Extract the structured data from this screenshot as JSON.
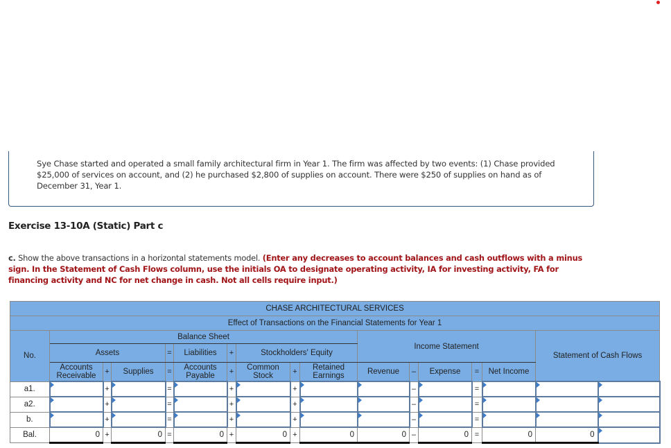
{
  "problem": {
    "text": "Sye Chase started and operated a small family architectural firm in Year 1. The firm was affected by two events: (1) Chase provided $25,000 of services on account, and (2) he purchased $2,800 of supplies on account. There were $250 of supplies on hand as of December 31, Year 1."
  },
  "exercise": {
    "title": "Exercise 13-10A (Static) Part c"
  },
  "instructions": {
    "part_label": "c.",
    "text": " Show the above transactions in a horizontal statements model. ",
    "note": "(Enter any decreases to account balances and cash outflows with a minus sign. In the Statement of Cash Flows column, use the initials OA to designate operating activity, IA for investing activity, FA for financing activity and NC for net change in cash. Not all cells require input.)"
  },
  "table": {
    "company": "CHASE ARCHITECTURAL SERVICES",
    "subtitle": "Effect of Transactions on the Financial Statements for Year 1",
    "no_header": "No.",
    "balance_sheet": "Balance Sheet",
    "income_statement": "Income Statement",
    "cash_flows": "Statement of Cash Flows",
    "assets": "Assets",
    "liabilities": "Liabilities",
    "equity": "Stockholders' Equity",
    "columns": {
      "accounts_receivable": "Accounts Receivable",
      "supplies": "Supplies",
      "accounts_payable": "Accounts Payable",
      "common_stock": "Common Stock",
      "retained_earnings": "Retained Earnings",
      "revenue": "Revenue",
      "expense": "Expense",
      "net_income": "Net Income"
    },
    "operators": {
      "plus": "+",
      "equals": "=",
      "minus": "–"
    },
    "rows": [
      {
        "label": "a1."
      },
      {
        "label": "a2."
      },
      {
        "label": "b."
      }
    ],
    "balance": {
      "label": "Bal.",
      "accounts_receivable": "0",
      "supplies": "0",
      "accounts_payable": "0",
      "common_stock": "0",
      "retained_earnings": "0",
      "revenue": "0",
      "expense": "0",
      "net_income": "0",
      "cash_flow_amount": "0",
      "cash_flow_code": ""
    }
  }
}
